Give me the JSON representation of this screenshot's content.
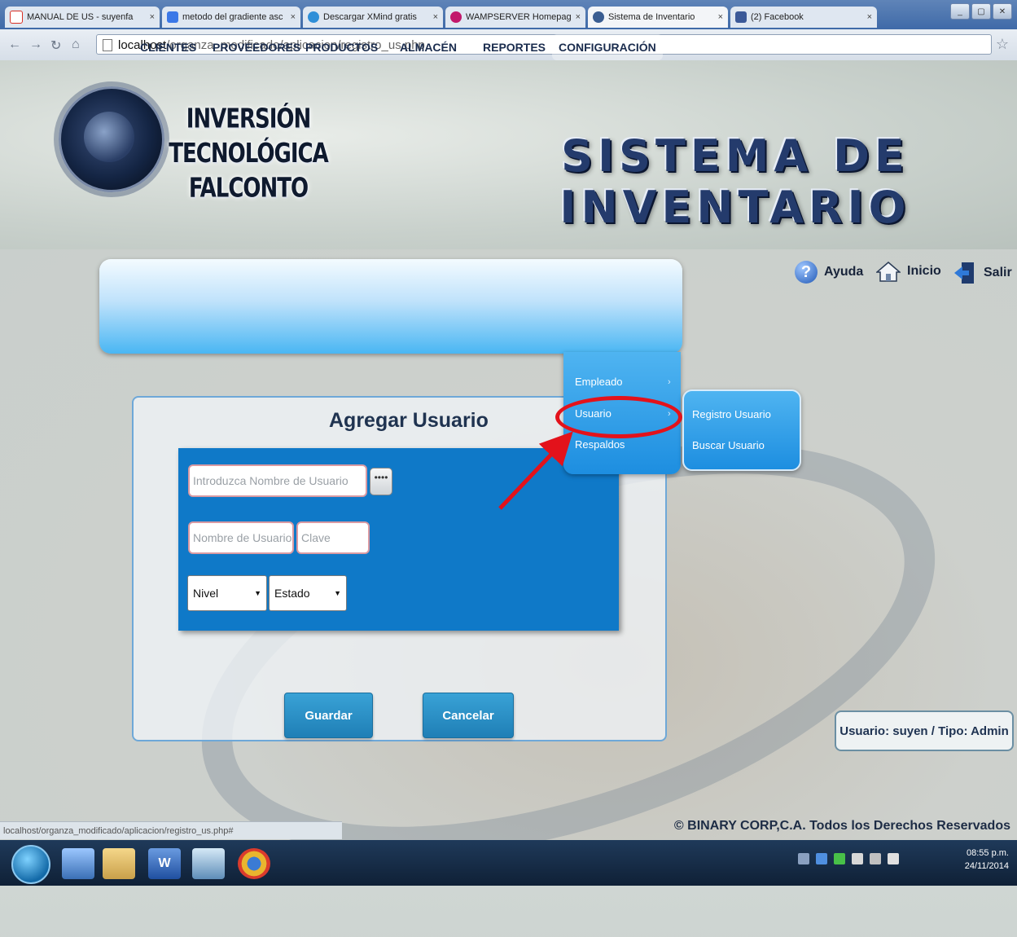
{
  "browser": {
    "tabs": [
      {
        "title": "MANUAL DE US - suyenfa",
        "icon": "gmail-icon",
        "color": "#d93025"
      },
      {
        "title": "metodo del gradiente asc",
        "icon": "search-icon",
        "color": "#3b78e7"
      },
      {
        "title": "Descargar XMind gratis",
        "icon": "download-icon",
        "color": "#2f8fd8"
      },
      {
        "title": "WAMPSERVER Homepage",
        "icon": "wamp-icon",
        "color": "#c2186b"
      },
      {
        "title": "Sistema de Inventario",
        "icon": "page-icon",
        "color": "#3a5d91"
      },
      {
        "title": "(2) Facebook",
        "icon": "facebook-icon",
        "color": "#3b5998"
      }
    ],
    "url_host": "localhost",
    "url_path": "/organza_modificado/aplicacion/registro_us.php",
    "status_url": "localhost/organza_modificado/aplicacion/registro_us.php#"
  },
  "header": {
    "logo_line1": "INVERSIÓN TECNOLÓGICA",
    "logo_line2": "FALCONTO",
    "system_title": "SISTEMA DE INVENTARIO"
  },
  "menu": {
    "items": [
      "CLIENTES",
      "PROVEEDORES",
      "PRODUCTOS",
      "ALMACÉN",
      "REPORTES",
      "CONFIGURACIÓN"
    ],
    "config_dropdown": [
      "Empleado",
      "Usuario",
      "Respaldos"
    ],
    "usuario_submenu": [
      "Registro Usuario",
      "Buscar Usuario"
    ]
  },
  "toplinks": {
    "help": "Ayuda",
    "home": "Inicio",
    "exit": "Salir"
  },
  "form": {
    "title": "Agregar Usuario",
    "name_placeholder": "Introduzca Nombre de Usuario",
    "dots_button": "••••",
    "username_placeholder": "Nombre de Usuario",
    "password_placeholder": "Clave",
    "nivel_selected": "Nivel",
    "estado_selected": "Estado",
    "save": "Guardar",
    "cancel": "Cancelar"
  },
  "session": {
    "status": "Usuario: suyen / Tipo: Admin"
  },
  "footer": {
    "copyright": "© BINARY CORP,C.A. Todos los Derechos Reservados"
  },
  "taskbar": {
    "time": "08:55 p.m.",
    "date": "24/11/2014"
  },
  "colors": {
    "accent": "#0f79c8",
    "annotation": "#e3121b"
  }
}
